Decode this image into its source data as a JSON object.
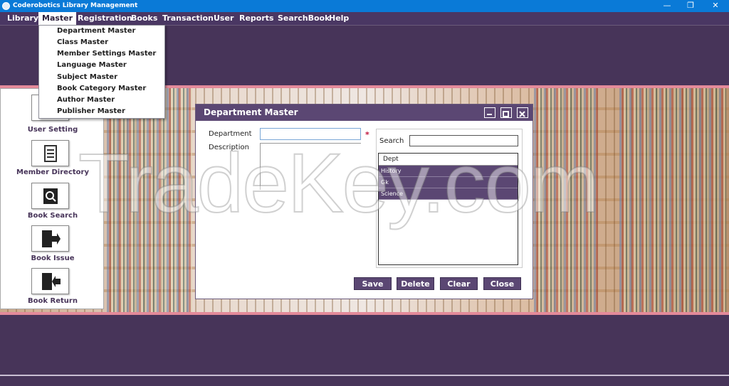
{
  "window": {
    "title": "Coderobotics Library Management",
    "minimize_glyph": "—",
    "restore_glyph": "❐",
    "close_glyph": "✕"
  },
  "menubar": {
    "items": [
      {
        "label": "Library"
      },
      {
        "label": "Master"
      },
      {
        "label": "Registration"
      },
      {
        "label": "Books"
      },
      {
        "label": "Transaction"
      },
      {
        "label": "User"
      },
      {
        "label": "Reports"
      },
      {
        "label": "SearchBook"
      },
      {
        "label": "Help"
      }
    ],
    "active": "Master"
  },
  "master_menu": {
    "items": [
      {
        "label": "Department Master"
      },
      {
        "label": "Class Master"
      },
      {
        "label": "Member Settings Master"
      },
      {
        "label": "Language Master"
      },
      {
        "label": "Subject Master"
      },
      {
        "label": "Book Category Master"
      },
      {
        "label": "Author Master"
      },
      {
        "label": "Publisher Master"
      }
    ]
  },
  "sidebar": {
    "items": [
      {
        "label": "User Setting",
        "icon": "user-setting-icon"
      },
      {
        "label": "Member Directory",
        "icon": "directory-icon"
      },
      {
        "label": "Book Search",
        "icon": "search-icon"
      },
      {
        "label": "Book Issue",
        "icon": "exit-door-icon"
      },
      {
        "label": "Book Return",
        "icon": "enter-door-icon"
      }
    ]
  },
  "dialog": {
    "title": "Department Master",
    "department_label": "Department",
    "department_value": "",
    "required_mark": "*",
    "description_label": "Description",
    "description_value": "",
    "search_label": "Search",
    "search_value": "",
    "list_header": "Dept",
    "list_rows": [
      "History",
      "Gk",
      "Science"
    ],
    "buttons": {
      "save": "Save",
      "delete": "Delete",
      "clear": "Clear",
      "close": "Close"
    }
  },
  "watermark": "TradeKey.com",
  "colors": {
    "titlebar": "#0a7ad7",
    "menubar": "#4a3763",
    "accent": "#5b4773",
    "pink_line": "#e38a9a"
  }
}
